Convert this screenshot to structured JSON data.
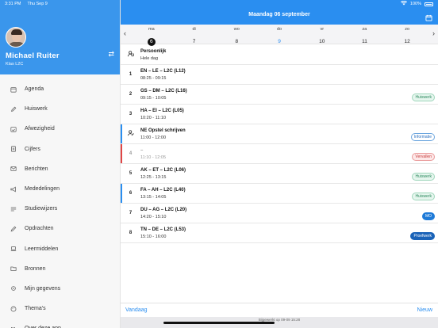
{
  "status": {
    "time": "3:31 PM",
    "date": "Thu Sep 9",
    "battery": "100%"
  },
  "profile": {
    "name": "Michael  Ruiter",
    "class": "Klas L2C"
  },
  "menu": [
    {
      "label": "Agenda",
      "icon": "calendar-icon"
    },
    {
      "label": "Huiswerk",
      "icon": "pencil-icon"
    },
    {
      "label": "Afwezigheid",
      "icon": "calendar-check-icon"
    },
    {
      "label": "Cijfers",
      "icon": "grades-icon"
    },
    {
      "label": "Berichten",
      "icon": "mail-icon"
    },
    {
      "label": "Mededelingen",
      "icon": "megaphone-icon"
    },
    {
      "label": "Studiewijzers",
      "icon": "list-icon"
    },
    {
      "label": "Opdrachten",
      "icon": "pen-icon"
    },
    {
      "label": "Leermiddelen",
      "icon": "laptop-icon"
    },
    {
      "label": "Bronnen",
      "icon": "folder-icon"
    },
    {
      "label": "Mijn gegevens",
      "icon": "gear-icon"
    },
    {
      "label": "Thema's",
      "icon": "palette-icon"
    },
    {
      "label": "Over deze app",
      "icon": "m-icon"
    }
  ],
  "header": {
    "title": "Maandag 06 september"
  },
  "week": [
    {
      "name": "ma",
      "date": "6"
    },
    {
      "name": "di",
      "date": "7"
    },
    {
      "name": "wo",
      "date": "8"
    },
    {
      "name": "do",
      "date": "9"
    },
    {
      "name": "vr",
      "date": "10"
    },
    {
      "name": "za",
      "date": "11"
    },
    {
      "name": "zo",
      "date": "12"
    }
  ],
  "lessons": [
    {
      "num": "",
      "title": "Persoonlijk",
      "time": "Hele dag"
    },
    {
      "num": "1",
      "title": "EN – LE – L2C (L12)",
      "time": "08:25 - 09:15"
    },
    {
      "num": "2",
      "title": "GS – DM – L2C (L16)",
      "time": "09:15 - 10:05",
      "badge": "Huiswerk"
    },
    {
      "num": "3",
      "title": "HA – EI – L2C (L05)",
      "time": "10:20 - 11:10"
    },
    {
      "num": "",
      "title": "NE Opstel schrijven",
      "time": "11:00 - 12:00",
      "badge": "Informatie"
    },
    {
      "num": "4",
      "title": "–",
      "time": "11:10 - 12:05",
      "badge": "Vervallen"
    },
    {
      "num": "5",
      "title": "AK – ET – L2C (L06)",
      "time": "12:25 - 13:15",
      "badge": "Huiswerk"
    },
    {
      "num": "6",
      "title": "FA – AH – L2C (L40)",
      "time": "13:15 - 14:05",
      "badge": "Huiswerk"
    },
    {
      "num": "7",
      "title": "DU – AG – L2C (L20)",
      "time": "14:20 - 15:10",
      "badge": "MO"
    },
    {
      "num": "8",
      "title": "TN – DE – L2C (L53)",
      "time": "15:10 - 16:00",
      "badge": "Proefwerk"
    }
  ],
  "footer": {
    "left": "Vandaag",
    "right": "Nieuw",
    "updated": "Bijgewerkt op 09-09 15:28"
  }
}
